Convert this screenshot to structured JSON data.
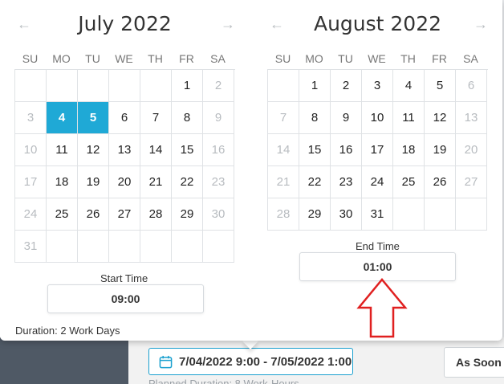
{
  "calendars": [
    {
      "title": "July 2022",
      "prev_icon": "←",
      "next_icon": "→",
      "weekdays": [
        "SU",
        "MO",
        "TU",
        "WE",
        "TH",
        "FR",
        "SA"
      ],
      "days": [
        {
          "t": "",
          "s": "empty"
        },
        {
          "t": "",
          "s": "empty"
        },
        {
          "t": "",
          "s": "empty"
        },
        {
          "t": "",
          "s": "empty"
        },
        {
          "t": "",
          "s": "empty"
        },
        {
          "t": "1",
          "s": ""
        },
        {
          "t": "2",
          "s": "muted"
        },
        {
          "t": "3",
          "s": "muted"
        },
        {
          "t": "4",
          "s": "sel"
        },
        {
          "t": "5",
          "s": "sel"
        },
        {
          "t": "6",
          "s": ""
        },
        {
          "t": "7",
          "s": ""
        },
        {
          "t": "8",
          "s": ""
        },
        {
          "t": "9",
          "s": "muted"
        },
        {
          "t": "10",
          "s": "muted"
        },
        {
          "t": "11",
          "s": ""
        },
        {
          "t": "12",
          "s": ""
        },
        {
          "t": "13",
          "s": ""
        },
        {
          "t": "14",
          "s": ""
        },
        {
          "t": "15",
          "s": ""
        },
        {
          "t": "16",
          "s": "muted"
        },
        {
          "t": "17",
          "s": "muted"
        },
        {
          "t": "18",
          "s": ""
        },
        {
          "t": "19",
          "s": ""
        },
        {
          "t": "20",
          "s": ""
        },
        {
          "t": "21",
          "s": ""
        },
        {
          "t": "22",
          "s": ""
        },
        {
          "t": "23",
          "s": "muted"
        },
        {
          "t": "24",
          "s": "muted"
        },
        {
          "t": "25",
          "s": ""
        },
        {
          "t": "26",
          "s": ""
        },
        {
          "t": "27",
          "s": ""
        },
        {
          "t": "28",
          "s": ""
        },
        {
          "t": "29",
          "s": ""
        },
        {
          "t": "30",
          "s": "muted"
        },
        {
          "t": "31",
          "s": "muted"
        },
        {
          "t": "",
          "s": "empty"
        },
        {
          "t": "",
          "s": "empty"
        },
        {
          "t": "",
          "s": "empty"
        },
        {
          "t": "",
          "s": "empty"
        },
        {
          "t": "",
          "s": "empty"
        },
        {
          "t": "",
          "s": "empty"
        }
      ]
    },
    {
      "title": "August 2022",
      "prev_icon": "←",
      "next_icon": "→",
      "weekdays": [
        "SU",
        "MO",
        "TU",
        "WE",
        "TH",
        "FR",
        "SA"
      ],
      "days": [
        {
          "t": "",
          "s": "empty"
        },
        {
          "t": "1",
          "s": ""
        },
        {
          "t": "2",
          "s": ""
        },
        {
          "t": "3",
          "s": ""
        },
        {
          "t": "4",
          "s": ""
        },
        {
          "t": "5",
          "s": ""
        },
        {
          "t": "6",
          "s": "muted"
        },
        {
          "t": "7",
          "s": "muted"
        },
        {
          "t": "8",
          "s": ""
        },
        {
          "t": "9",
          "s": ""
        },
        {
          "t": "10",
          "s": ""
        },
        {
          "t": "11",
          "s": ""
        },
        {
          "t": "12",
          "s": ""
        },
        {
          "t": "13",
          "s": "muted"
        },
        {
          "t": "14",
          "s": "muted"
        },
        {
          "t": "15",
          "s": ""
        },
        {
          "t": "16",
          "s": ""
        },
        {
          "t": "17",
          "s": ""
        },
        {
          "t": "18",
          "s": ""
        },
        {
          "t": "19",
          "s": ""
        },
        {
          "t": "20",
          "s": "muted"
        },
        {
          "t": "21",
          "s": "muted"
        },
        {
          "t": "22",
          "s": ""
        },
        {
          "t": "23",
          "s": ""
        },
        {
          "t": "24",
          "s": ""
        },
        {
          "t": "25",
          "s": ""
        },
        {
          "t": "26",
          "s": ""
        },
        {
          "t": "27",
          "s": "muted"
        },
        {
          "t": "28",
          "s": "muted"
        },
        {
          "t": "29",
          "s": ""
        },
        {
          "t": "30",
          "s": ""
        },
        {
          "t": "31",
          "s": ""
        },
        {
          "t": "",
          "s": "empty"
        },
        {
          "t": "",
          "s": "empty"
        },
        {
          "t": "",
          "s": "empty"
        }
      ]
    }
  ],
  "start_time": {
    "label": "Start Time",
    "value": "09:00"
  },
  "end_time": {
    "label": "End Time",
    "value": "01:00"
  },
  "duration": "Duration: 2 Work Days",
  "date_range_button": {
    "label": "7/04/2022 9:00 - 7/05/2022 1:00",
    "icon": "calendar-icon"
  },
  "planned_duration": "Planned Duration: 8 Work-Hours",
  "asap_button": "As Soon As Possible",
  "colors": {
    "accent": "#1fa9d6",
    "annotation": "#e02020"
  }
}
